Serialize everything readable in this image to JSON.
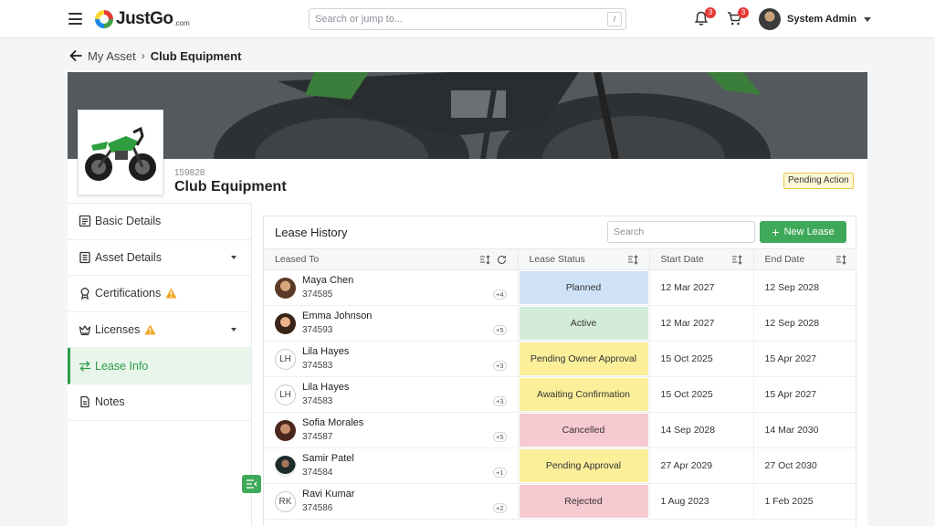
{
  "header": {
    "logo_text": "JustGo",
    "logo_suffix": ".com",
    "search_placeholder": "Search or jump to...",
    "search_shortcut": "/",
    "notifications_count": "3",
    "cart_count": "3",
    "user_name": "System Admin"
  },
  "breadcrumb": {
    "parent": "My Asset",
    "current": "Club Equipment"
  },
  "asset": {
    "id": "159828",
    "title": "Club Equipment",
    "status_badge": "Pending Action"
  },
  "sidenav": {
    "items": [
      {
        "label": "Basic Details",
        "icon": "details-icon"
      },
      {
        "label": "Asset Details",
        "icon": "document-icon",
        "has_dropdown": true
      },
      {
        "label": "Certifications",
        "icon": "certificate-icon",
        "warning": true
      },
      {
        "label": "Licenses",
        "icon": "crown-icon",
        "warning": true,
        "has_dropdown": true
      },
      {
        "label": "Lease Info",
        "icon": "swap-icon",
        "active": true
      },
      {
        "label": "Notes",
        "icon": "notes-icon"
      }
    ]
  },
  "lease": {
    "title": "Lease History",
    "search_placeholder": "Search",
    "new_button": "New Lease",
    "columns": [
      "Leased To",
      "Lease Status",
      "Start Date",
      "End Date"
    ],
    "rows": [
      {
        "name": "Maya Chen",
        "id": "374585",
        "avatar": "photo",
        "extra": "+4",
        "status": "Planned",
        "start": "12 Mar 2027",
        "end": "12 Sep 2028"
      },
      {
        "name": "Emma Johnson",
        "id": "374593",
        "avatar": "photo",
        "extra": "+5",
        "status": "Active",
        "start": "12 Mar 2027",
        "end": "12 Sep 2028"
      },
      {
        "name": "Lila Hayes",
        "id": "374583",
        "avatar": "LH",
        "extra": "+3",
        "status": "Pending Owner Approval",
        "start": "15 Oct 2025",
        "end": "15 Apr 2027"
      },
      {
        "name": "Lila Hayes",
        "id": "374583",
        "avatar": "LH",
        "extra": "+3",
        "status": "Awaiting Confirmation",
        "start": "15 Oct 2025",
        "end": "15 Apr 2027"
      },
      {
        "name": "Sofia Morales",
        "id": "374587",
        "avatar": "photo",
        "extra": "+5",
        "status": "Cancelled",
        "start": "14 Sep 2028",
        "end": "14 Mar 2030"
      },
      {
        "name": "Samir Patel",
        "id": "374584",
        "avatar": "photo",
        "extra": "+1",
        "status": "Pending Approval",
        "start": "27 Apr 2029",
        "end": "27 Oct 2030"
      },
      {
        "name": "Ravi Kumar",
        "id": "374586",
        "avatar": "RK",
        "extra": "+2",
        "status": "Rejected",
        "start": "1 Aug 2023",
        "end": "1 Feb 2025"
      }
    ]
  },
  "colors": {
    "accent": "#3fa95a",
    "planned": "#cfe2f7",
    "active": "#d3ecd8",
    "pending": "#fbef9a",
    "negative": "#f7c9d0"
  }
}
